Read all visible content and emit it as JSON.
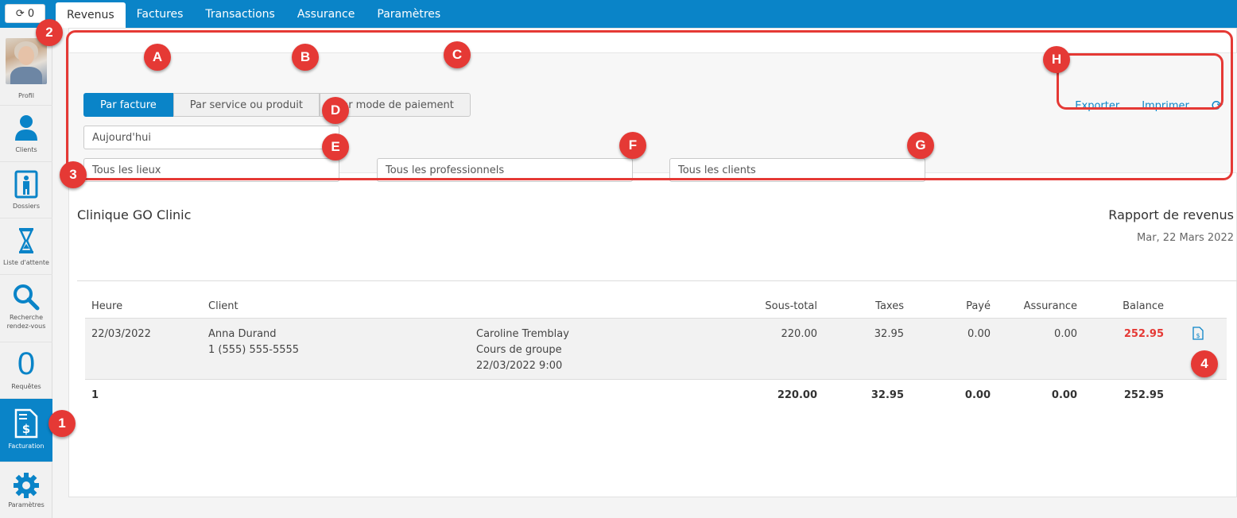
{
  "topbar": {
    "refresh_count": "0",
    "tabs": [
      "Revenus",
      "Factures",
      "Transactions",
      "Assurance",
      "Paramètres"
    ]
  },
  "sidebar": {
    "items": [
      {
        "label": "Profil",
        "icon": "avatar"
      },
      {
        "label": "Clients",
        "icon": "person-icon"
      },
      {
        "label": "Dossiers",
        "icon": "folder-person-icon"
      },
      {
        "label": "Liste d'attente",
        "icon": "hourglass-icon"
      },
      {
        "label": "Recherche rendez-vous",
        "icon": "search-icon"
      },
      {
        "label": "Requêtes",
        "icon": "counter",
        "count": "0"
      },
      {
        "label": "Facturation",
        "icon": "invoice-icon"
      },
      {
        "label": "Paramètres",
        "icon": "gear-icon"
      }
    ],
    "active": "Facturation"
  },
  "filters": {
    "segments": [
      "Par facture",
      "Par service ou produit",
      "Par mode de paiement"
    ],
    "active_segment": "Par facture",
    "date": "Aujourd'hui",
    "location": "Tous les lieux",
    "professional": "Tous les professionnels",
    "client": "Tous les clients"
  },
  "actions": {
    "export": "Exporter",
    "print": "Imprimer"
  },
  "report": {
    "clinic": "Clinique GO Clinic",
    "title": "Rapport de revenus",
    "date": "Mar, 22 Mars 2022",
    "columns": [
      "Heure",
      "Client",
      "Sous-total",
      "Taxes",
      "Payé",
      "Assurance",
      "Balance"
    ],
    "rows": [
      {
        "heure": "22/03/2022",
        "client_name": "Anna Durand",
        "client_phone": "1 (555) 555-5555",
        "professional": "Caroline Tremblay",
        "service": "Cours de groupe",
        "appointment": "22/03/2022 9:00",
        "subtotal": "220.00",
        "taxes": "32.95",
        "paid": "0.00",
        "insurance": "0.00",
        "balance": "252.95"
      }
    ],
    "totals": {
      "count": "1",
      "subtotal": "220.00",
      "taxes": "32.95",
      "paid": "0.00",
      "insurance": "0.00",
      "balance": "252.95"
    }
  },
  "annotations": {
    "numbers": [
      "1",
      "2",
      "3",
      "4"
    ],
    "letters": [
      "A",
      "B",
      "C",
      "D",
      "E",
      "F",
      "G",
      "H"
    ]
  },
  "colors": {
    "brand": "#0a84c8",
    "annotation": "#e53935",
    "balance": "#e53935"
  }
}
